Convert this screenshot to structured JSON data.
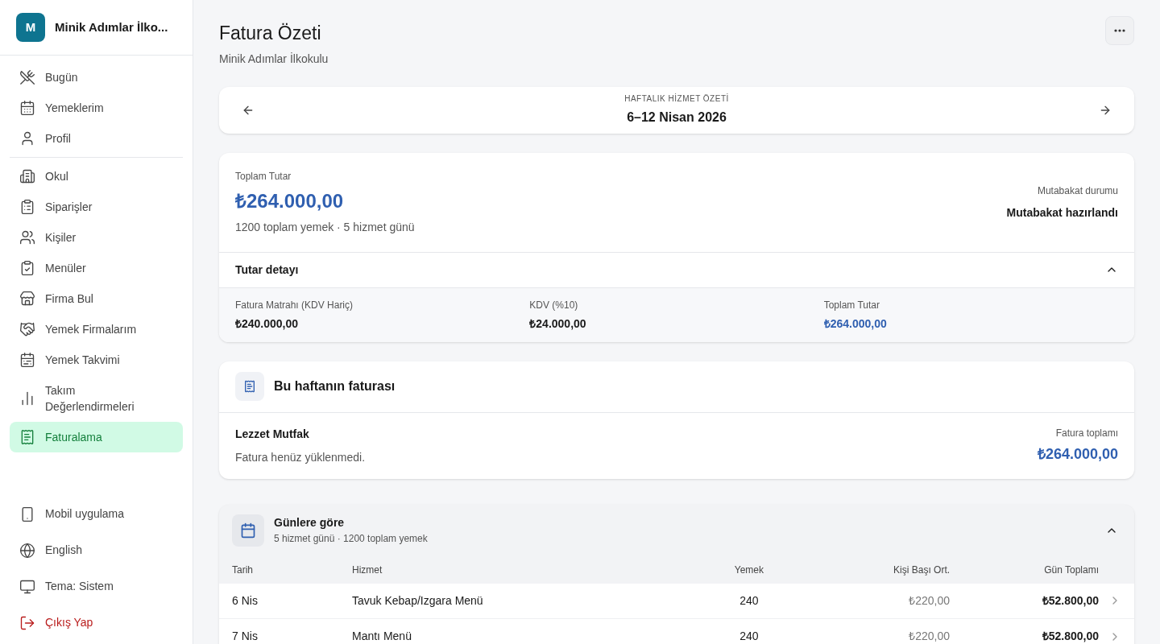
{
  "sidebar": {
    "org": {
      "initial": "M",
      "name": "Minik Adımlar İlko..."
    },
    "groups": [
      [
        {
          "label": "Bugün",
          "selected": false
        },
        {
          "label": "Yemeklerim",
          "selected": false
        },
        {
          "label": "Profil",
          "selected": false
        }
      ],
      [
        {
          "label": "Okul",
          "selected": false
        },
        {
          "label": "Siparişler",
          "selected": false
        },
        {
          "label": "Kişiler",
          "selected": false
        },
        {
          "label": "Menüler",
          "selected": false
        },
        {
          "label": "Firma Bul",
          "selected": false
        },
        {
          "label": "Yemek Firmalarım",
          "selected": false
        },
        {
          "label": "Yemek Takvimi",
          "selected": false
        },
        {
          "label": "Takım Değerlendirmeleri",
          "selected": false
        },
        {
          "label": "Faturalama",
          "selected": true
        }
      ]
    ],
    "footer": [
      {
        "label": "Mobil uygulama",
        "kind": "normal"
      },
      {
        "label": "English",
        "kind": "normal"
      },
      {
        "label": "Tema: Sistem",
        "kind": "normal"
      },
      {
        "label": "Çıkış Yap",
        "kind": "danger"
      }
    ]
  },
  "header": {
    "title": "Fatura Özeti",
    "subtitle": "Minik Adımlar İlkokulu"
  },
  "week_nav": {
    "caption": "HAFTALIK HİZMET ÖZETİ",
    "range": "6–12 Nisan 2026"
  },
  "summary": {
    "total_label": "Toplam Tutar",
    "total": "₺264.000,00",
    "meta": "1200 toplam yemek · 5 hizmet günü",
    "status_label": "Mutabakat durumu",
    "status": "Mutabakat hazırlandı",
    "detail": {
      "title": "Tutar detayı",
      "expanded": true,
      "items": [
        {
          "label": "Fatura Matrahı (KDV Hariç)",
          "value": "₺240.000,00",
          "kind": "plain"
        },
        {
          "label": "KDV (%10)",
          "value": "₺24.000,00",
          "kind": "plain"
        },
        {
          "label": "Toplam Tutar",
          "value": "₺264.000,00",
          "kind": "total"
        }
      ]
    }
  },
  "invoice": {
    "title": "Bu haftanın faturası",
    "vendor": "Lezzet Mutfak",
    "note": "Fatura henüz yüklenmedi.",
    "total_label": "Fatura toplamı",
    "total": "₺264.000,00"
  },
  "days": {
    "title": "Günlere göre",
    "meta": "5 hizmet günü · 1200 toplam yemek",
    "expanded": true,
    "columns": [
      "Tarih",
      "Hizmet",
      "Yemek",
      "Kişi Başı Ort.",
      "Gün Toplamı"
    ],
    "rows": [
      {
        "date": "6 Nis",
        "service": "Tavuk Kebap/Izgara Menü",
        "meals": "240",
        "avg": "₺220,00",
        "total": "₺52.800,00"
      },
      {
        "date": "7 Nis",
        "service": "Mantı Menü",
        "meals": "240",
        "avg": "₺220,00",
        "total": "₺52.800,00"
      }
    ]
  }
}
